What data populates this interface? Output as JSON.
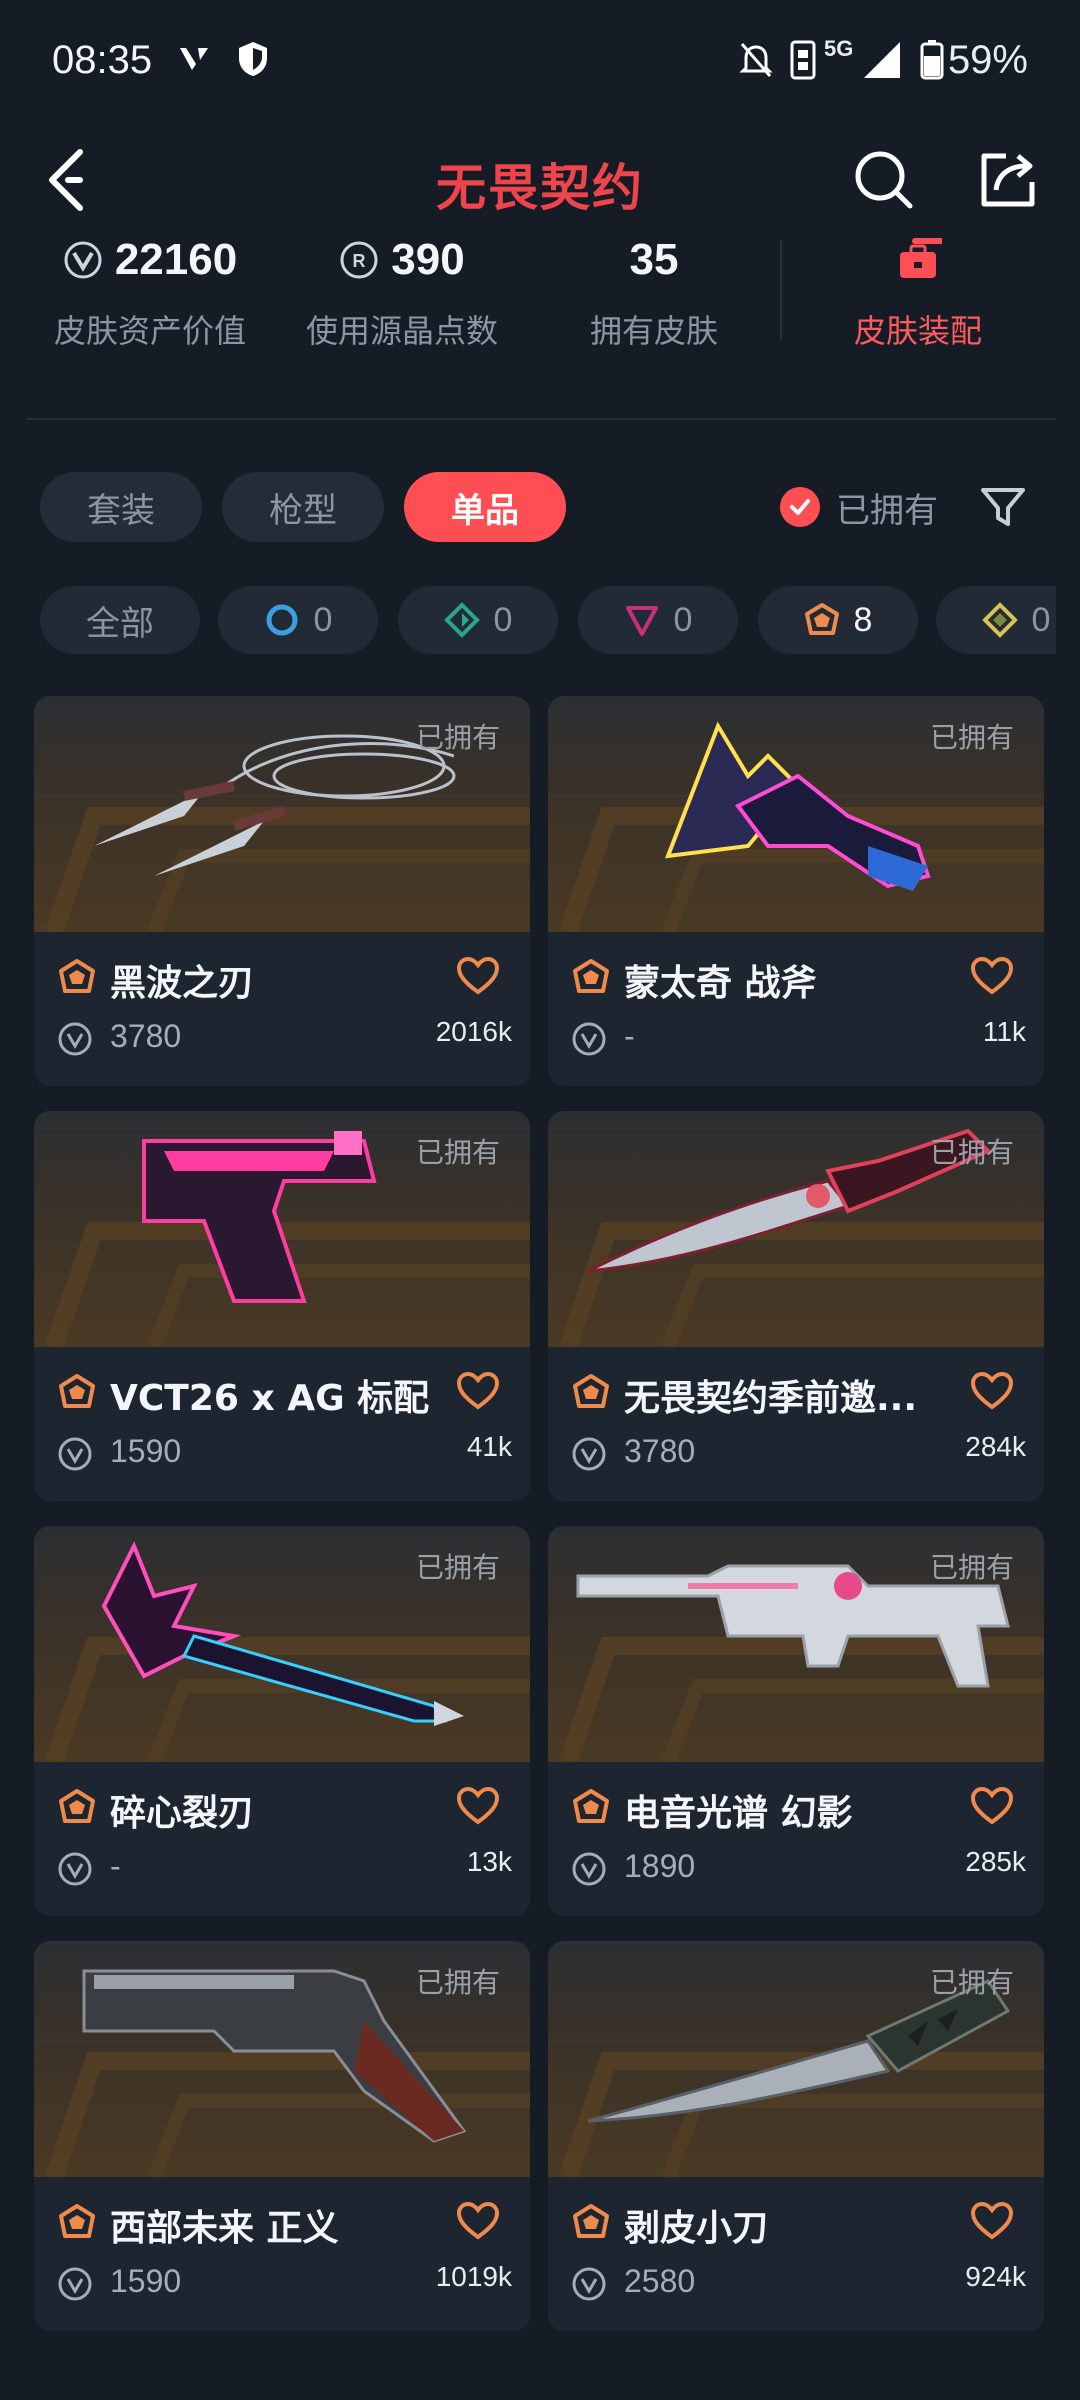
{
  "status_bar": {
    "time": "08:35",
    "battery": "59%",
    "network": "5G"
  },
  "header": {
    "title": "无畏契约"
  },
  "stats": [
    {
      "value": "22160",
      "label": "皮肤资产价值",
      "icon": "vp-icon"
    },
    {
      "value": "390",
      "label": "使用源晶点数",
      "icon": "radianite-icon"
    },
    {
      "value": "35",
      "label": "拥有皮肤",
      "icon": ""
    },
    {
      "value": "",
      "label": "皮肤装配",
      "icon": "briefcase-icon"
    }
  ],
  "tabs": [
    {
      "label": "套装",
      "active": false
    },
    {
      "label": "枪型",
      "active": false
    },
    {
      "label": "单品",
      "active": true
    }
  ],
  "owned_filter": {
    "label": "已拥有",
    "checked": true
  },
  "tiers": [
    {
      "label": "全部",
      "count": ""
    },
    {
      "label": "",
      "count": "0",
      "icon": "select-tier-icon",
      "color": "#3aa0e0"
    },
    {
      "label": "",
      "count": "0",
      "icon": "deluxe-tier-icon",
      "color": "#26a88f"
    },
    {
      "label": "",
      "count": "0",
      "icon": "premium-tier-icon",
      "color": "#c4307a"
    },
    {
      "label": "",
      "count": "8",
      "icon": "exclusive-tier-icon",
      "color": "#f08a4b"
    },
    {
      "label": "",
      "count": "0",
      "icon": "ultra-tier-icon",
      "color": "#d8c155"
    }
  ],
  "owned_badge": "已拥有",
  "items": [
    {
      "name": "黑波之刃",
      "price": "3780",
      "likes": "2016k",
      "weapon": "kunai"
    },
    {
      "name": "蒙太奇 战斧",
      "price": "-",
      "likes": "11k",
      "weapon": "axe"
    },
    {
      "name": "VCT26 x AG 标配",
      "price": "1590",
      "likes": "41k",
      "weapon": "pistol"
    },
    {
      "name": "无畏契约季前邀...",
      "price": "3780",
      "likes": "284k",
      "weapon": "dagger"
    },
    {
      "name": "碎心裂刃",
      "price": "-",
      "likes": "13k",
      "weapon": "guitar-blade"
    },
    {
      "name": "电音光谱 幻影",
      "price": "1890",
      "likes": "285k",
      "weapon": "rifle"
    },
    {
      "name": "西部未来 正义",
      "price": "1590",
      "likes": "1019k",
      "weapon": "revolver"
    },
    {
      "name": "剥皮小刀",
      "price": "2580",
      "likes": "924k",
      "weapon": "knife"
    }
  ],
  "colors": {
    "accent": "#ff4f55",
    "background": "#151c26",
    "tier_exclusive": "#f08a4b"
  }
}
